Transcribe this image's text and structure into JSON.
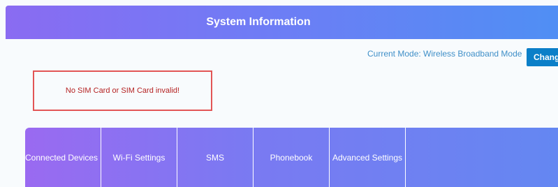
{
  "header": {
    "title": "System Information"
  },
  "mode": {
    "label": "Current Mode: Wireless Broadband Mode",
    "change_button": "Chang"
  },
  "sim_status": {
    "message": "No SIM Card or SIM Card invalid!"
  },
  "nav": {
    "items": [
      {
        "label": "Connected Devices"
      },
      {
        "label": "Wi-Fi Settings"
      },
      {
        "label": "SMS"
      },
      {
        "label": "Phonebook"
      },
      {
        "label": "Advanced Settings"
      }
    ]
  },
  "colors": {
    "header_gradient_start": "#8a6bf2",
    "header_gradient_end": "#4f8ff4",
    "accent_blue": "#0b7fc8",
    "mode_text": "#3f8fc8",
    "error_border": "#e25555",
    "error_text": "#b52222"
  }
}
